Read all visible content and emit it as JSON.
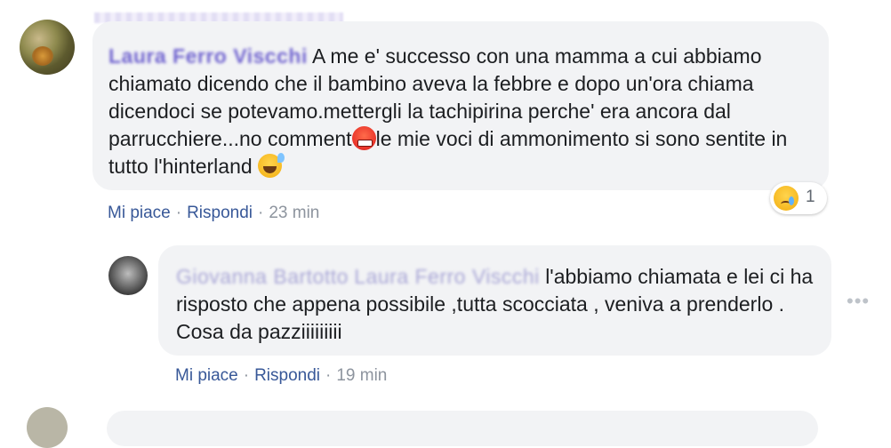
{
  "comment1": {
    "author": "Laura Ferro Viscchi",
    "text": "A me e' successo con una mamma a cui abbiamo chiamato dicendo che il bambino aveva la febbre e dopo un'ora chiama dicendoci se potevamo.mettergli la tachipirina perche' era ancora dal parrucchiere...no comment",
    "text_after_emoji": "le mie voci di ammonimento si sono sentite in tutto l'hinterland",
    "emoji1": "angry-face-icon",
    "emoji2": "grinning-sweat-icon",
    "like_label": "Mi piace",
    "reply_label": "Rispondi",
    "time": "23 min",
    "reaction": {
      "icon": "crying-face-icon",
      "count": "1"
    }
  },
  "reply1": {
    "author": "Giovanna Bartotto",
    "tag": "Laura Ferro Viscchi",
    "text": "l'abbiamo chiamata e lei ci ha risposto che appena possibile ,tutta scocciata , veniva a prenderlo . Cosa da pazziiiiiiiii",
    "like_label": "Mi piace",
    "reply_label": "Rispondi",
    "time": "19 min",
    "more_icon": "more-options-icon",
    "more_glyph": "•••"
  },
  "separator": "·"
}
